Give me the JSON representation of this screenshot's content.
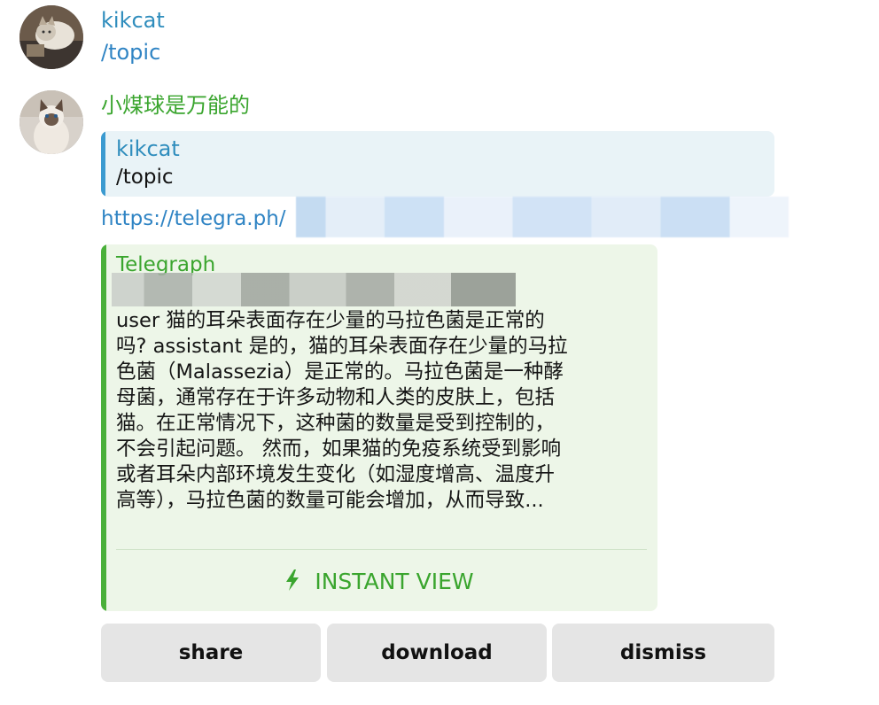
{
  "messages": [
    {
      "sender": "kikcat",
      "sender_color": "#2f8dbd",
      "text": "/topic"
    },
    {
      "sender": "小煤球是万能的",
      "sender_color": "#3aa52e",
      "reply": {
        "name": "kikcat",
        "text": "/topic"
      },
      "link": "https://telegra.ph/",
      "preview": {
        "site": "Telegraph",
        "description": "user 猫的耳朵表面存在少量的马拉色菌是正常的\n吗? assistant 是的，猫的耳朵表面存在少量的马拉\n色菌（Malassezia）是正常的。马拉色菌是一种酵\n母菌，通常存在于许多动物和人类的皮肤上，包括\n猫。在正常情况下，这种菌的数量是受到控制的，\n不会引起问题。 然而，如果猫的免疫系统受到影响\n或者耳朵内部环境发生变化（如湿度增高、温度升\n高等），马拉色菌的数量可能会增加，从而导致...",
        "instant_view_label": "INSTANT VIEW",
        "accent": "#4ab03a"
      }
    }
  ],
  "buttons": [
    {
      "label": "share"
    },
    {
      "label": "download"
    },
    {
      "label": "dismiss"
    }
  ]
}
